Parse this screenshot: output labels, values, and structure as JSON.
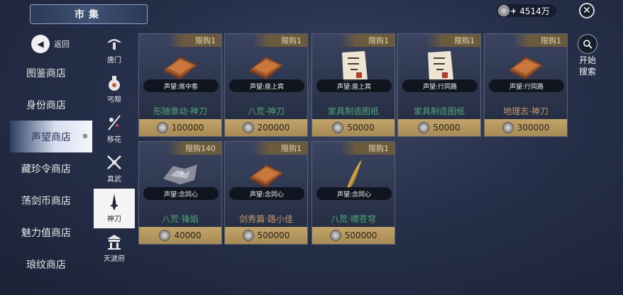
{
  "header": {
    "title": "市集"
  },
  "currency": {
    "amount": "4514万",
    "plus": "+"
  },
  "search": {
    "label_line1": "开始",
    "label_line2": "搜索"
  },
  "back": {
    "label": "返回"
  },
  "left_nav": {
    "items": [
      {
        "label": "图鉴商店"
      },
      {
        "label": "身份商店"
      },
      {
        "label": "声望商店",
        "active": true
      },
      {
        "label": "藏珍令商店"
      },
      {
        "label": "荡剑币商店"
      },
      {
        "label": "魅力值商店"
      },
      {
        "label": "琅纹商店"
      }
    ]
  },
  "sub_nav": {
    "items": [
      {
        "label": "唐门",
        "icon": "tangmen-icon"
      },
      {
        "label": "丐帮",
        "icon": "gaibang-icon"
      },
      {
        "label": "移花",
        "icon": "yihua-icon"
      },
      {
        "label": "真武",
        "icon": "zhenwu-icon"
      },
      {
        "label": "神刀",
        "icon": "shendao-icon",
        "active": true
      },
      {
        "label": "天波府",
        "icon": "tianbofu-icon"
      }
    ]
  },
  "products": [
    {
      "limit": "限购1",
      "requirement": "声望:席中客",
      "name": "形随意动·神刀",
      "price": "100000",
      "icon": "book-icon"
    },
    {
      "limit": "限购1",
      "requirement": "声望:座上宾",
      "name": "八荒·神刀",
      "price": "200000",
      "icon": "book-icon"
    },
    {
      "limit": "限购1",
      "requirement": "声望:座上宾",
      "name": "家具制造图纸",
      "price": "50000",
      "icon": "blueprint-icon"
    },
    {
      "limit": "限购1",
      "requirement": "声望:行同路",
      "name": "家具制造图纸",
      "price": "50000",
      "icon": "blueprint-icon"
    },
    {
      "limit": "限购1",
      "requirement": "声望:行同路",
      "name": "地理志·神刀",
      "price": "300000",
      "icon": "book-icon"
    },
    {
      "limit": "限购140",
      "requirement": "声望:念同心",
      "name": "八荒·锋焰",
      "price": "40000",
      "icon": "ore-icon"
    },
    {
      "limit": "限购1",
      "requirement": "声望:念同心",
      "name": "剑秀篇·路小佳",
      "price": "500000",
      "icon": "book-icon"
    },
    {
      "limit": "限购1",
      "requirement": "声望:念同心",
      "name": "八荒·啸苍穹",
      "price": "500000",
      "icon": "feather-icon"
    }
  ],
  "colors": {
    "price_bg": "#c2a469",
    "name_green": "#4ea876",
    "name_gold": "#c69a6a"
  }
}
